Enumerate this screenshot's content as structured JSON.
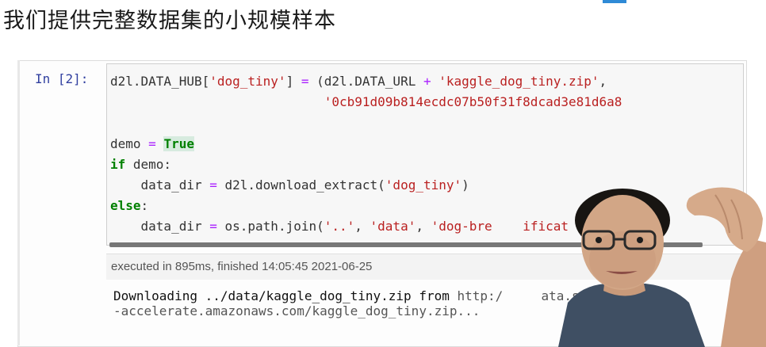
{
  "page": {
    "heading": "我们提供完整数据集的小规模样本"
  },
  "cell": {
    "prompt": "In [2]:",
    "code": {
      "l1_a": "d2l.DATA_HUB[",
      "l1_b": "'dog_tiny'",
      "l1_c": "] ",
      "l1_d": "=",
      "l1_e": " (d2l.DATA_URL ",
      "l1_f": "+",
      "l1_g": " ",
      "l1_h": "'kaggle_dog_tiny.zip'",
      "l1_i": ",",
      "l2_a": "                            ",
      "l2_b": "'0cb91d09b814ecdc07b50f31f8dcad3e81d6a8",
      "l4_a": "demo ",
      "l4_b": "=",
      "l4_c": " ",
      "l4_d": "True",
      "l5_a": "if",
      "l5_b": " demo:",
      "l6_a": "    data_dir ",
      "l6_b": "=",
      "l6_c": " d2l.download_extract(",
      "l6_d": "'dog_tiny'",
      "l6_e": ")",
      "l7_a": "else",
      "l7_b": ":",
      "l8_a": "    data_dir ",
      "l8_b": "=",
      "l8_c": " os.path.join(",
      "l8_d": "'..'",
      "l8_e": ", ",
      "l8_f": "'data'",
      "l8_g": ", ",
      "l8_h": "'dog-bre",
      "l8_i": "    ificat"
    },
    "execution_info": "executed in 895ms, finished 14:05:45 2021-06-25",
    "output": {
      "line1_a": "Downloading ../data/kaggle_dog_tiny.zip from ",
      "line1_b": "http:/",
      "line1_c": "     ",
      "line1_d": "ata.s3",
      "line2": "-accelerate.amazonaws.com/kaggle_dog_tiny.zip..."
    }
  },
  "colors": {
    "keyword": "#008000",
    "string": "#ba2121",
    "operator": "#aa22ff",
    "prompt": "#303f9f"
  }
}
